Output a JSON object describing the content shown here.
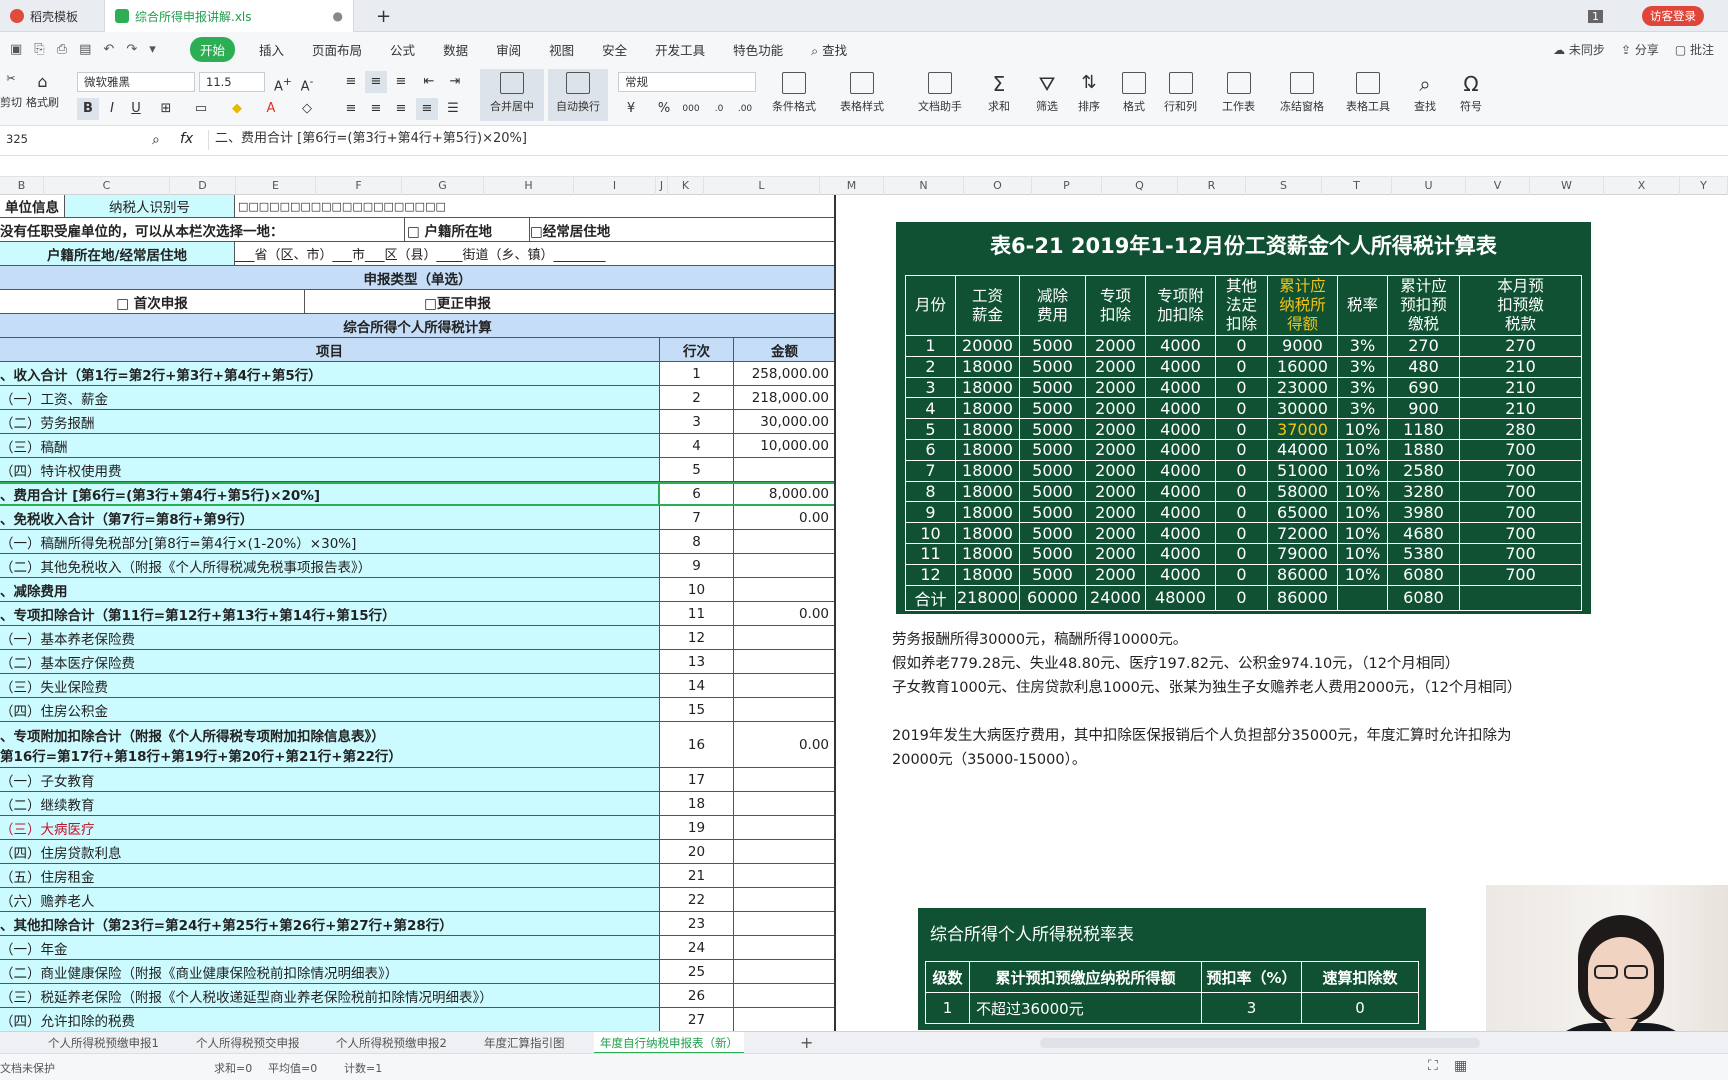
{
  "tabs": {
    "template": "稻壳模板",
    "file": "综合所得申报讲解.xls",
    "login": "访客登录",
    "badge": "1"
  },
  "menu": [
    "开始",
    "插入",
    "页面布局",
    "公式",
    "数据",
    "审阅",
    "视图",
    "安全",
    "开发工具",
    "特色功能",
    "查找"
  ],
  "menu_right": {
    "sync": "未同步",
    "share": "分享",
    "comment": "批注"
  },
  "toolbar": {
    "cut": "剪切",
    "format_painter": "格式刷",
    "font_name": "微软雅黑",
    "font_size": "11.5",
    "merge": "合并居中",
    "wrap": "自动换行",
    "number_format": "常规",
    "cond_format": "条件格式",
    "table_style": "表格样式",
    "doc_helper": "文档助手",
    "sum": "求和",
    "filter": "筛选",
    "sort": "排序",
    "format": "格式",
    "rowcol": "行和列",
    "worksheet": "工作表",
    "freeze": "冻结窗格",
    "table_tools": "表格工具",
    "find": "查找",
    "symbol": "符号"
  },
  "formula_bar": {
    "cell_ref": "325",
    "fx": "fx",
    "content": "二、费用合计 [第6行=(第3行+第4行+第5行)×20%]"
  },
  "columns": [
    "B",
    "C",
    "D",
    "E",
    "F",
    "G",
    "H",
    "I",
    "J",
    "K",
    "L",
    "M",
    "N",
    "O",
    "P",
    "Q",
    "R",
    "S",
    "T",
    "U",
    "V",
    "W",
    "X",
    "Y"
  ],
  "sheet": {
    "row1": {
      "label": "单位信息",
      "id_label": "纳税人识别号",
      "boxes": "□□□□□□□□□□□□□□□□□□□□"
    },
    "row2": {
      "text": "没有任职受雇单位的，可以从本栏次选择一地：",
      "opt1": "□ 户籍所在地",
      "opt2": "□经常居住地"
    },
    "row3": {
      "label": "户籍所在地/经常居住地",
      "addr": "___省（区、市）___市___区（县）____街道（乡、镇）________"
    },
    "row4": "申报类型（单选）",
    "row5": {
      "opt1": "□ 首次申报",
      "opt2": "□更正申报"
    },
    "row6": "综合所得个人所得税计算",
    "header": {
      "item": "项目",
      "line": "行次",
      "amount": "金额"
    },
    "items": [
      {
        "label": "、收入合计（第1行=第2行+第3行+第4行+第5行）",
        "line": "1",
        "amount": "258,000.00",
        "bold": true
      },
      {
        "label": "（一）工资、薪金",
        "line": "2",
        "amount": "218,000.00"
      },
      {
        "label": "（二）劳务报酬",
        "line": "3",
        "amount": "30,000.00"
      },
      {
        "label": "（三）稿酬",
        "line": "4",
        "amount": "10,000.00"
      },
      {
        "label": "（四）特许权使用费",
        "line": "5",
        "amount": ""
      },
      {
        "label": "、费用合计 [第6行=(第3行+第4行+第5行)×20%]",
        "line": "6",
        "amount": "8,000.00",
        "bold": true
      },
      {
        "label": "、免税收入合计（第7行=第8行+第9行）",
        "line": "7",
        "amount": "0.00",
        "bold": true
      },
      {
        "label": "（一）稿酬所得免税部分[第8行=第4行×(1-20%）×30%]",
        "line": "8",
        "amount": ""
      },
      {
        "label": "（二）其他免税收入（附报《个人所得税减免税事项报告表》）",
        "line": "9",
        "amount": ""
      },
      {
        "label": "、减除费用",
        "line": "10",
        "amount": "",
        "bold": true
      },
      {
        "label": "、专项扣除合计（第11行=第12行+第13行+第14行+第15行）",
        "line": "11",
        "amount": "0.00",
        "bold": true
      },
      {
        "label": "（一）基本养老保险费",
        "line": "12",
        "amount": ""
      },
      {
        "label": "（二）基本医疗保险费",
        "line": "13",
        "amount": ""
      },
      {
        "label": "（三）失业保险费",
        "line": "14",
        "amount": ""
      },
      {
        "label": "（四）住房公积金",
        "line": "15",
        "amount": ""
      },
      {
        "label": "、专项附加扣除合计（附报《个人所得税专项附加扣除信息表》）",
        "label2": "第16行=第17行+第18行+第19行+第20行+第21行+第22行）",
        "line": "16",
        "amount": "0.00",
        "bold": true
      },
      {
        "label": "（一）子女教育",
        "line": "17",
        "amount": ""
      },
      {
        "label": "（二）继续教育",
        "line": "18",
        "amount": ""
      },
      {
        "label": "（三）大病医疗",
        "line": "19",
        "amount": "",
        "red": true
      },
      {
        "label": "（四）住房贷款利息",
        "line": "20",
        "amount": ""
      },
      {
        "label": "（五）住房租金",
        "line": "21",
        "amount": ""
      },
      {
        "label": "（六）赡养老人",
        "line": "22",
        "amount": ""
      },
      {
        "label": "、其他扣除合计（第23行=第24行+第25行+第26行+第27行+第28行）",
        "line": "23",
        "amount": "",
        "bold": true
      },
      {
        "label": "（一）年金",
        "line": "24",
        "amount": ""
      },
      {
        "label": "（二）商业健康保险（附报《商业健康保险税前扣除情况明细表》）",
        "line": "25",
        "amount": ""
      },
      {
        "label": "（三）税延养老保险（附报《个人税收递延型商业养老保险税前扣除情况明细表》）",
        "line": "26",
        "amount": ""
      },
      {
        "label": "（四）允许扣除的税费",
        "line": "27",
        "amount": ""
      }
    ]
  },
  "table621": {
    "title": "表6-21  2019年1-12月份工资薪金个人所得税计算表",
    "headers": [
      "月份",
      "工资\n薪金",
      "减除\n费用",
      "专项\n扣除",
      "专项附\n加扣除",
      "其他\n法定\n扣除",
      "累计应\n纳税所\n得额",
      "税率",
      "累计应\n预扣预\n缴税",
      "本月预\n扣预缴\n税款"
    ],
    "rows": [
      [
        "1",
        "20000",
        "5000",
        "2000",
        "4000",
        "0",
        "9000",
        "3%",
        "270",
        "270"
      ],
      [
        "2",
        "18000",
        "5000",
        "2000",
        "4000",
        "0",
        "16000",
        "3%",
        "480",
        "210"
      ],
      [
        "3",
        "18000",
        "5000",
        "2000",
        "4000",
        "0",
        "23000",
        "3%",
        "690",
        "210"
      ],
      [
        "4",
        "18000",
        "5000",
        "2000",
        "4000",
        "0",
        "30000",
        "3%",
        "900",
        "210"
      ],
      [
        "5",
        "18000",
        "5000",
        "2000",
        "4000",
        "0",
        "37000",
        "10%",
        "1180",
        "280"
      ],
      [
        "6",
        "18000",
        "5000",
        "2000",
        "4000",
        "0",
        "44000",
        "10%",
        "1880",
        "700"
      ],
      [
        "7",
        "18000",
        "5000",
        "2000",
        "4000",
        "0",
        "51000",
        "10%",
        "2580",
        "700"
      ],
      [
        "8",
        "18000",
        "5000",
        "2000",
        "4000",
        "0",
        "58000",
        "10%",
        "3280",
        "700"
      ],
      [
        "9",
        "18000",
        "5000",
        "2000",
        "4000",
        "0",
        "65000",
        "10%",
        "3980",
        "700"
      ],
      [
        "10",
        "18000",
        "5000",
        "2000",
        "4000",
        "0",
        "72000",
        "10%",
        "4680",
        "700"
      ],
      [
        "11",
        "18000",
        "5000",
        "2000",
        "4000",
        "0",
        "79000",
        "10%",
        "5380",
        "700"
      ],
      [
        "12",
        "18000",
        "5000",
        "2000",
        "4000",
        "0",
        "86000",
        "10%",
        "6080",
        "700"
      ],
      [
        "合计",
        "218000",
        "60000",
        "24000",
        "48000",
        "0",
        "86000",
        "",
        "6080",
        ""
      ]
    ]
  },
  "notes": [
    "劳务报酬所得30000元，稿酬所得10000元。",
    "假如养老779.28元、失业48.80元、医疗197.82元、公积金974.10元，（12个月相同）",
    "子女教育1000元、住房贷款利息1000元、张某为独生子女赡养老人费用2000元，（12个月相同）",
    "2019年发生大病医疗费用，其中扣除医保报销后个人负担部分35000元，年度汇算时允许扣除为",
    "20000元（35000-15000）。"
  ],
  "rate_table": {
    "title": "综合所得个人所得税税率表",
    "headers": [
      "级数",
      "累计预扣预缴应纳税所得额",
      "预扣率（%）",
      "速算扣除数"
    ],
    "row1": [
      "1",
      "不超过36000元",
      "3",
      "0"
    ]
  },
  "sheet_tabs": [
    "个人所得税预缴申报1",
    "个人所得税预交申报",
    "个人所得税预缴申报2",
    "年度汇算指引图",
    "年度自行纳税申报表（新）"
  ],
  "status": {
    "protect": "文档未保护",
    "sum": "求和=0",
    "avg": "平均值=0",
    "count": "计数=1"
  }
}
